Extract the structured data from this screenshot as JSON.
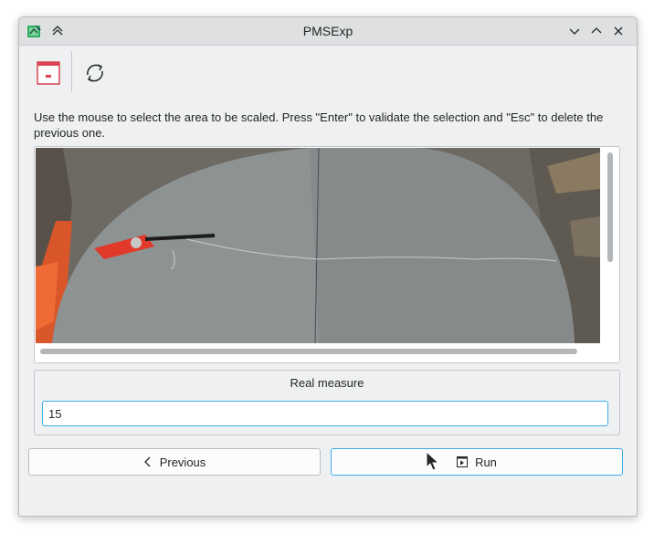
{
  "window": {
    "title": "PMSExp"
  },
  "toolbar": {
    "items": [
      {
        "icon": "window-minimize-red-icon"
      },
      {
        "icon": "refresh-icon"
      }
    ]
  },
  "instructions": "Use the mouse to select the area to be scaled. Press \"Enter\" to validate the selection and \"Esc\" to delete the previous one.",
  "image_panel": {
    "description_icon": "video-frame"
  },
  "measure": {
    "group_title": "Real measure",
    "value": "15"
  },
  "buttons": {
    "previous_label": "Previous",
    "run_label": "Run"
  },
  "colors": {
    "accent": "#3daee9",
    "window_bg": "#eff0f1",
    "toolbar_icon_red": "#da4453"
  }
}
